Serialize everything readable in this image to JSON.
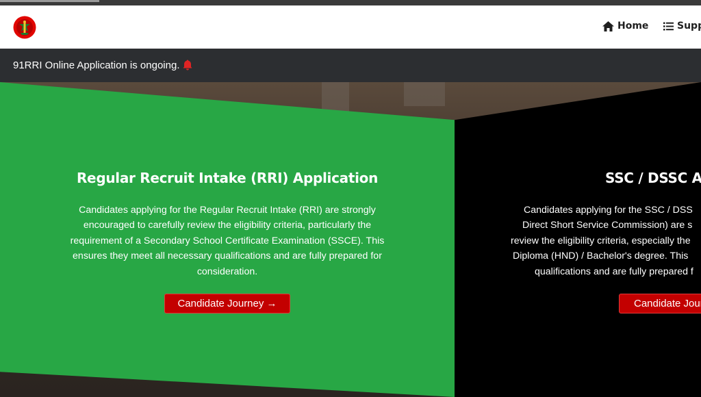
{
  "nav": {
    "home_label": "Home",
    "support_label": "Supp"
  },
  "announcement": {
    "text": "91RRI Online Application is ongoing."
  },
  "panels": [
    {
      "title": "Regular Recruit Intake (RRI) Application",
      "lines": [
        "Candidates applying for the Regular Recruit Intake (RRI) are strongly",
        "encouraged to carefully review the eligibility criteria, particularly the",
        "requirement of a Secondary School Certificate Examination (SSCE). This",
        "ensures they meet all necessary qualifications and are fully prepared for",
        "consideration."
      ],
      "button_label": "Candidate Journey →"
    },
    {
      "title": "SSC / DSSC Ap",
      "lines": [
        "Candidates applying for the SSC / DSS",
        "Direct Short Service Commission) are s",
        "review the eligibility criteria, especially the",
        "Diploma (HND) / Bachelor's degree. This",
        "qualifications and are fully prepared f"
      ],
      "button_label": "Candidate Jour"
    }
  ],
  "colors": {
    "green_panel": "#28a745",
    "black_panel": "#000000",
    "button": "#c30000",
    "announcement_bar": "#2c2e31",
    "bell": "#e02424"
  }
}
